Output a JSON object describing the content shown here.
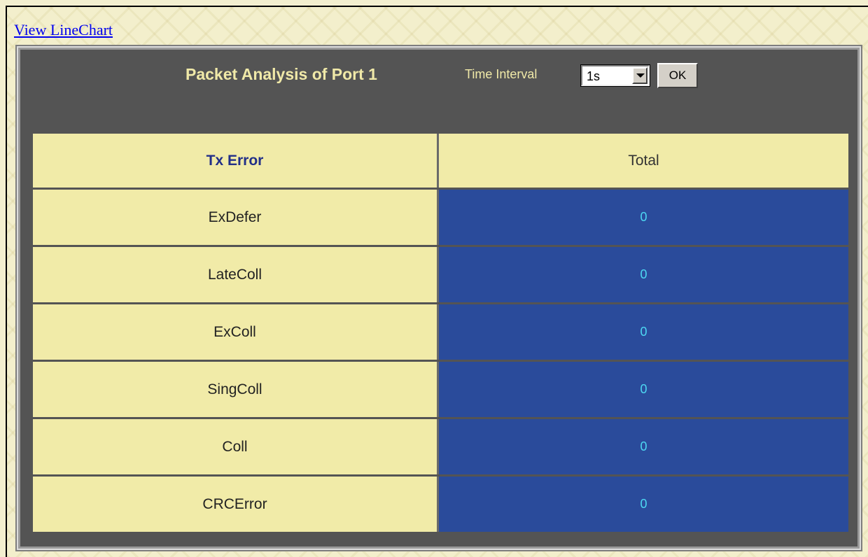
{
  "link": {
    "label": "View LineChart"
  },
  "panel": {
    "title": "Packet Analysis of Port 1",
    "interval_label": "Time Interval",
    "interval_value": "1s",
    "ok_label": "OK"
  },
  "table": {
    "headers": [
      "Tx Error",
      "Total"
    ],
    "rows": [
      {
        "name": "ExDefer",
        "total": "0"
      },
      {
        "name": "LateColl",
        "total": "0"
      },
      {
        "name": "ExColl",
        "total": "0"
      },
      {
        "name": "SingColl",
        "total": "0"
      },
      {
        "name": "Coll",
        "total": "0"
      },
      {
        "name": "CRCError",
        "total": "0"
      }
    ]
  },
  "colors": {
    "panel_bg": "#545454",
    "label_cell": "#f1eba8",
    "value_cell": "#2a4b9b",
    "value_text": "#4dd7f2",
    "title_text": "#f0e9a8"
  }
}
